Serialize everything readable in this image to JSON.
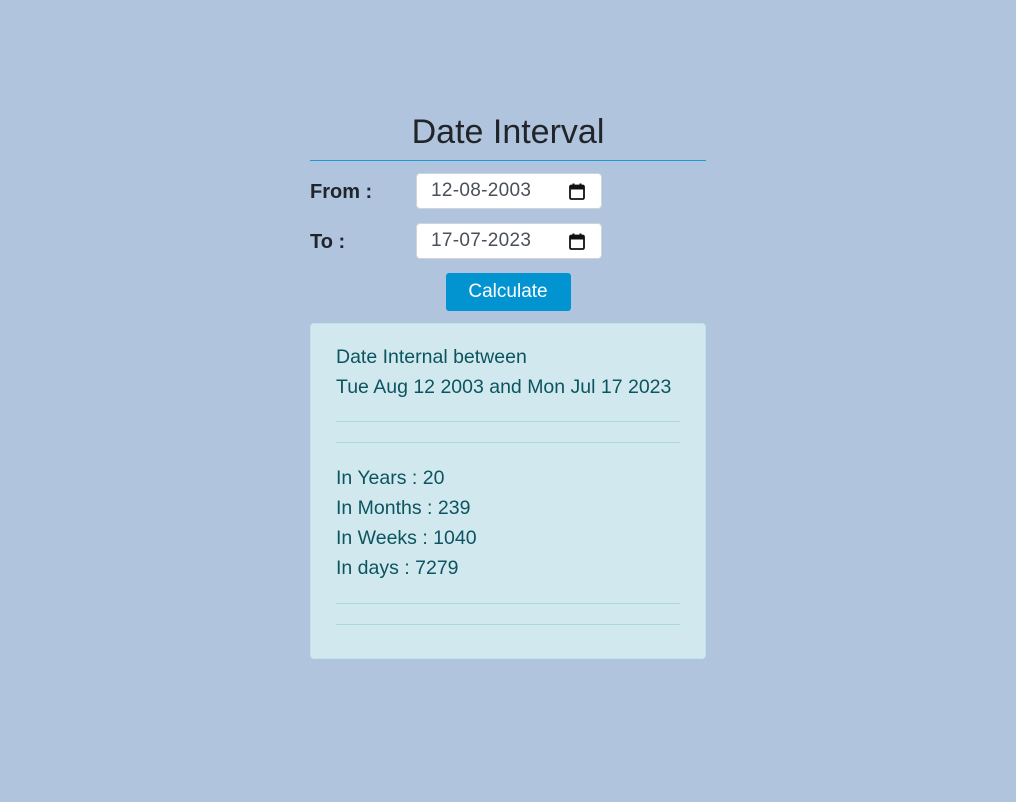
{
  "title": "Date Interval",
  "form": {
    "from_label": "From :",
    "from_value": "12-08-2003",
    "to_label": "To :",
    "to_value": "17-07-2023",
    "calculate_label": "Calculate"
  },
  "result": {
    "heading": "Date Internal between",
    "range": "Tue Aug 12 2003 and Mon Jul 17 2023",
    "years": "In Years : 20",
    "months": "In Months : 239",
    "weeks": "In Weeks : 1040",
    "days": "In days : 7279"
  },
  "icons": {
    "calendar": "calendar-icon"
  },
  "colors": {
    "background": "#b0c4de",
    "accent": "#0294d0",
    "result_bg": "#d1e9ee",
    "result_text": "#0c5460"
  }
}
